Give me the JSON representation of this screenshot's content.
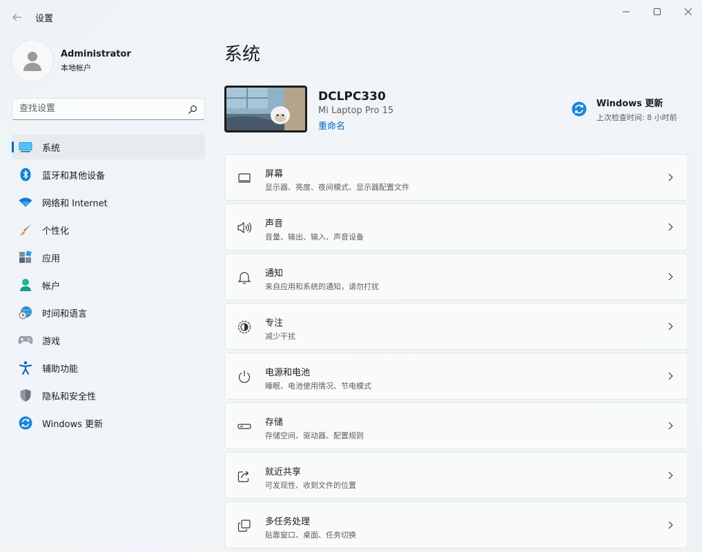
{
  "window": {
    "title": "设置"
  },
  "profile": {
    "name": "Administrator",
    "account_type": "本地帐户"
  },
  "search": {
    "placeholder": "查找设置"
  },
  "sidebar": {
    "items": [
      {
        "label": "系统",
        "icon": "system-display-icon",
        "active": true
      },
      {
        "label": "蓝牙和其他设备",
        "icon": "bluetooth-icon"
      },
      {
        "label": "网络和 Internet",
        "icon": "wifi-icon"
      },
      {
        "label": "个性化",
        "icon": "paintbrush-icon"
      },
      {
        "label": "应用",
        "icon": "apps-icon"
      },
      {
        "label": "帐户",
        "icon": "account-icon"
      },
      {
        "label": "时间和语言",
        "icon": "globe-clock-icon"
      },
      {
        "label": "游戏",
        "icon": "gamepad-icon"
      },
      {
        "label": "辅助功能",
        "icon": "accessibility-icon"
      },
      {
        "label": "隐私和安全性",
        "icon": "shield-icon"
      },
      {
        "label": "Windows 更新",
        "icon": "windows-update-icon"
      }
    ]
  },
  "main": {
    "title": "系统",
    "device": {
      "name": "DCLPC330",
      "model": "Mi Laptop Pro 15",
      "rename_label": "重命名"
    },
    "windows_update": {
      "title": "Windows 更新",
      "last_checked": "上次检查时间: 8 小时前"
    },
    "cards": [
      {
        "title": "屏幕",
        "desc": "显示器、亮度、夜间模式、显示器配置文件",
        "icon": "monitor-icon"
      },
      {
        "title": "声音",
        "desc": "音量、输出、输入、声音设备",
        "icon": "speaker-icon"
      },
      {
        "title": "通知",
        "desc": "来自应用和系统的通知，请勿打扰",
        "icon": "bell-icon"
      },
      {
        "title": "专注",
        "desc": "减少干扰",
        "icon": "focus-icon"
      },
      {
        "title": "电源和电池",
        "desc": "睡眠、电池使用情况、节电模式",
        "icon": "power-icon"
      },
      {
        "title": "存储",
        "desc": "存储空间、驱动器、配置规则",
        "icon": "storage-icon"
      },
      {
        "title": "就近共享",
        "desc": "可发现性、收到文件的位置",
        "icon": "share-icon"
      },
      {
        "title": "多任务处理",
        "desc": "贴靠窗口、桌面、任务切换",
        "icon": "multitask-icon"
      }
    ]
  },
  "colors": {
    "accent": "#0067c0",
    "background": "#eef3f7",
    "card": "#f9fbfb"
  }
}
